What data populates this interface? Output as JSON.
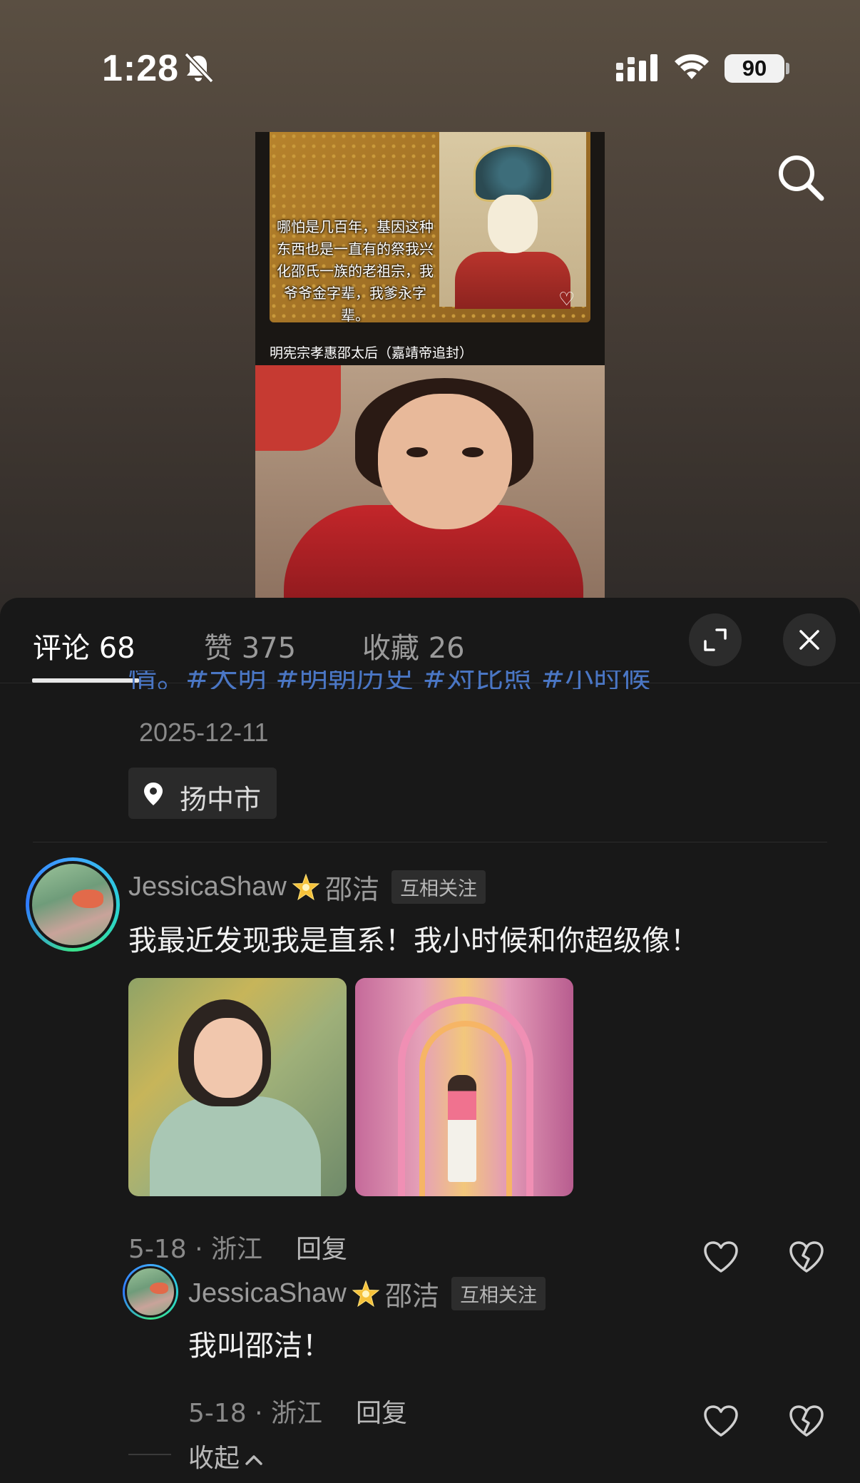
{
  "status_bar": {
    "time": "1:28",
    "battery": "90",
    "icons": [
      "bell-slash-icon",
      "signal-icon",
      "wifi-icon",
      "battery-icon"
    ]
  },
  "post": {
    "image_caption_main": "哪怕是几百年，基因这种东西也是一直有的祭我兴化邵氏一族的老祖宗，我爷爷金字辈，我爹永字辈。",
    "image_caption_bottom": "明宪宗孝惠邵太后（嘉靖帝追封）",
    "tags_line": "情。#大明 #明朝历史 #对比照 #小时候",
    "date": "2025-12-11",
    "location": "扬中市"
  },
  "tabs": [
    {
      "label": "评论 68",
      "active": true
    },
    {
      "label": "赞 375",
      "active": false
    },
    {
      "label": "收藏 26",
      "active": false
    }
  ],
  "comment": {
    "username": "JessicaShaw",
    "real_name": "邵洁",
    "badge": "互相关注",
    "text": "我最近发现我是直系！我小时候和你超级像！",
    "meta": "5-18 · 浙江",
    "reply_label": "回复"
  },
  "reply": {
    "username": "JessicaShaw",
    "real_name": "邵洁",
    "badge": "互相关注",
    "text": "我叫邵洁！",
    "meta": "5-18 · 浙江",
    "reply_label": "回复"
  },
  "collapse_label": "收起",
  "colors": {
    "background": "#181818",
    "hashtag": "#4a76c4",
    "muted_text": "#8a8a8a"
  }
}
